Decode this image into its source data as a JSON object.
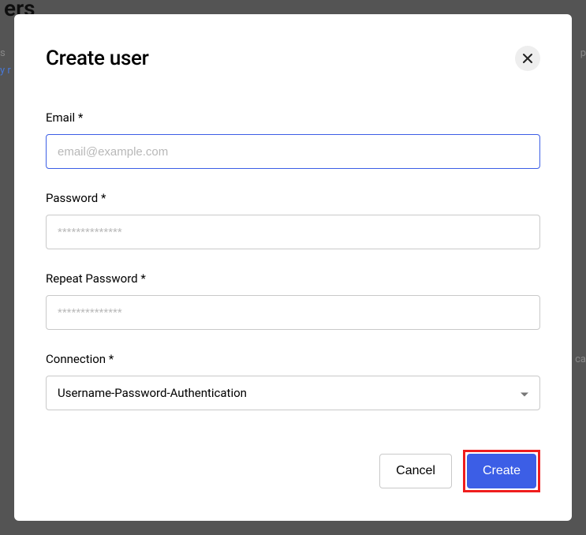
{
  "background": {
    "partial_heading": "ers",
    "left_frag_1": "s",
    "left_frag_2": "y r",
    "right_frag": "p",
    "right_frag_2": "ca"
  },
  "modal": {
    "title": "Create user",
    "close_label": "Close"
  },
  "form": {
    "email": {
      "label": "Email *",
      "placeholder": "email@example.com",
      "value": ""
    },
    "password": {
      "label": "Password *",
      "placeholder": "**************",
      "value": ""
    },
    "repeat_password": {
      "label": "Repeat Password *",
      "placeholder": "**************",
      "value": ""
    },
    "connection": {
      "label": "Connection *",
      "selected": "Username-Password-Authentication"
    }
  },
  "buttons": {
    "cancel": "Cancel",
    "create": "Create"
  }
}
